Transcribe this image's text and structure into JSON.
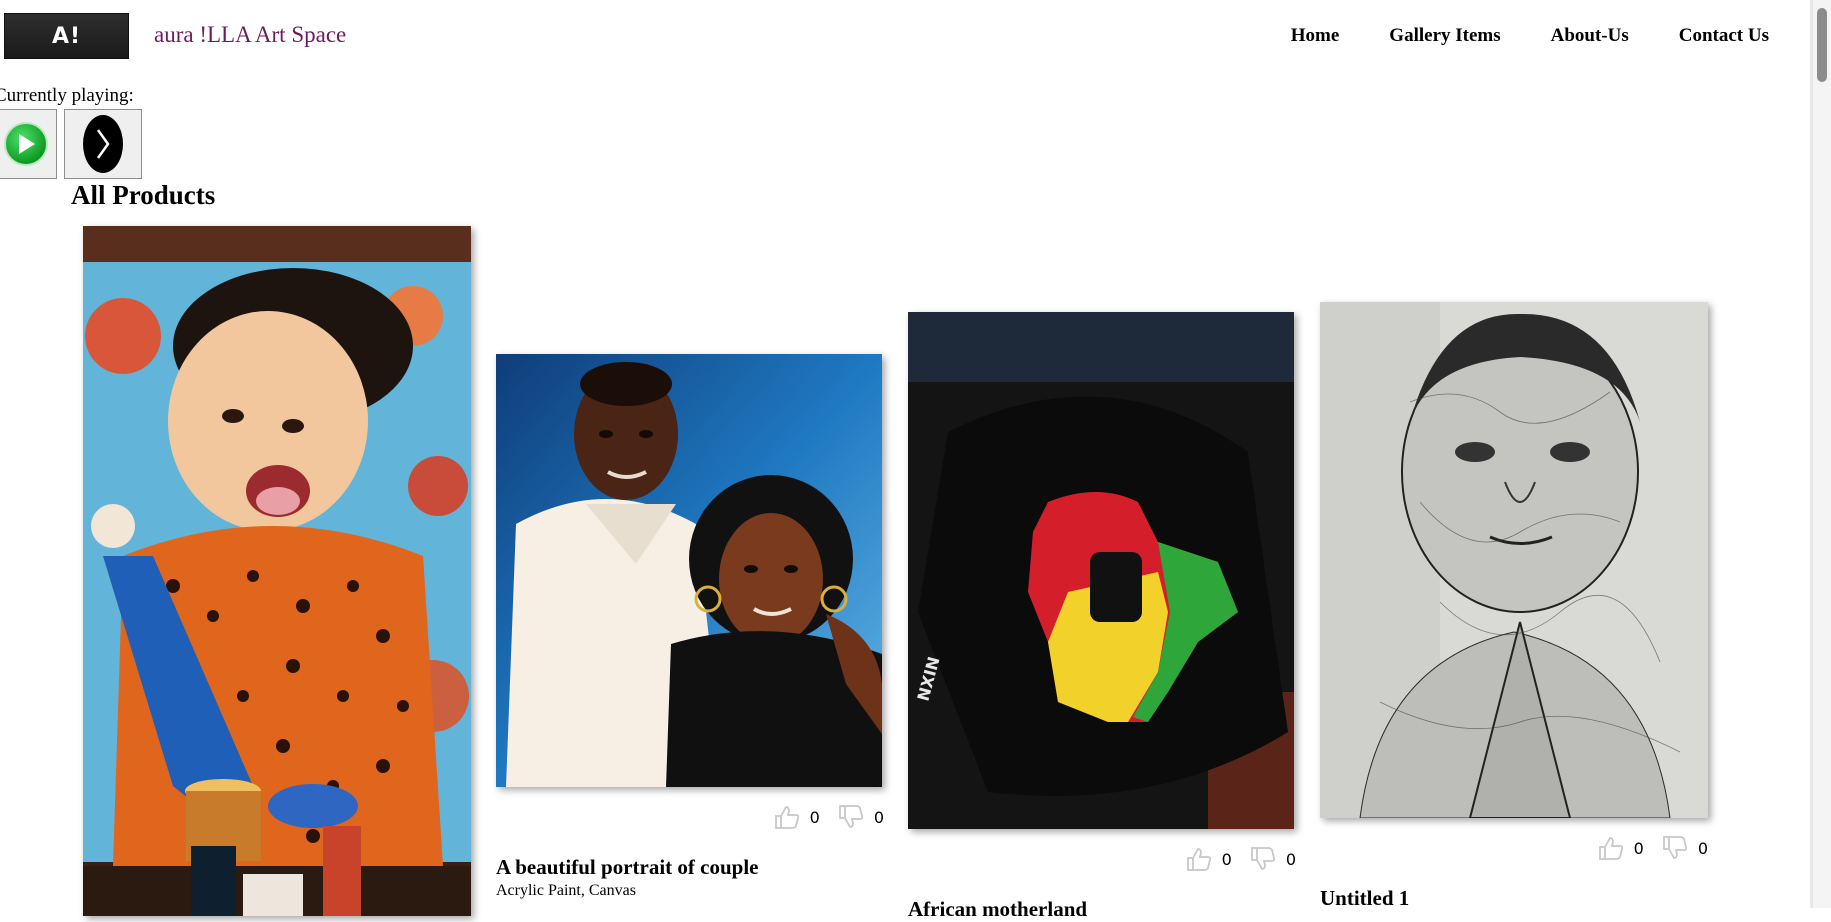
{
  "header": {
    "logo_text": "A!",
    "site_name": "aura !LLA Art Space",
    "nav": [
      "Home",
      "Gallery Items",
      "About-Us",
      "Contact Us"
    ]
  },
  "player": {
    "label": "Currently playing:"
  },
  "main": {
    "heading": "All Products",
    "products": [
      {
        "title": "",
        "subtitle": "",
        "likes": "",
        "dislikes": ""
      },
      {
        "title": "A beautiful portrait of couple",
        "subtitle": "Acrylic Paint, Canvas",
        "likes": "0",
        "dislikes": "0"
      },
      {
        "title": "African motherland",
        "subtitle": "",
        "likes": "0",
        "dislikes": "0"
      },
      {
        "title": "Untitled 1",
        "subtitle": "",
        "likes": "0",
        "dislikes": "0"
      }
    ]
  },
  "colors": {
    "site_name": "#6e1a5e",
    "play_button": "#0e9b22",
    "vote_icon": "#c8c8c8"
  },
  "icons": [
    "play-icon",
    "next-icon",
    "thumbs-up-icon",
    "thumbs-down-icon"
  ]
}
